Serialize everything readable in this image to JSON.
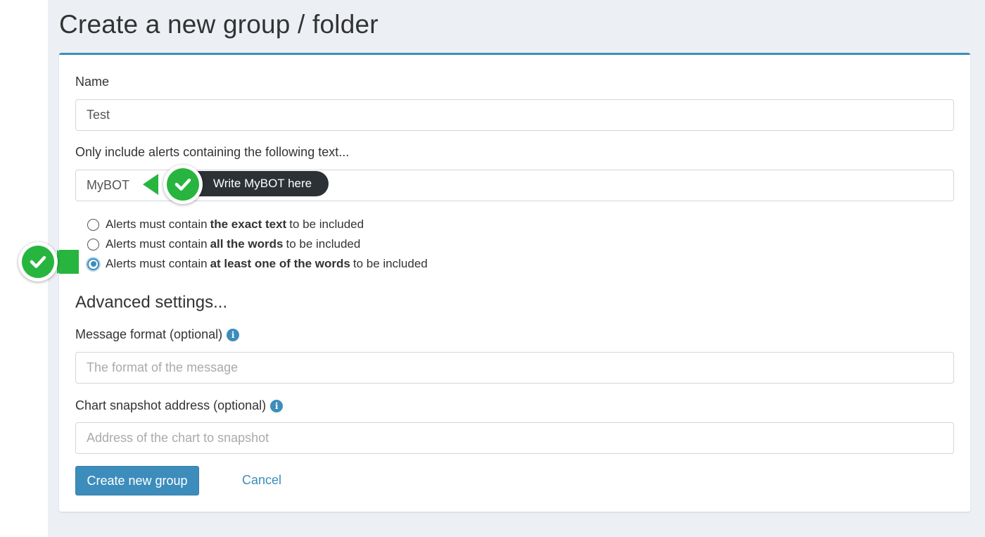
{
  "page": {
    "title": "Create a new group / folder"
  },
  "form": {
    "name_label": "Name",
    "name_value": "Test",
    "filter_label": "Only include alerts containing the following text...",
    "filter_value": "MyBOT",
    "match_options": [
      {
        "prefix": "Alerts must contain",
        "bold": "the exact text",
        "suffix": "to be included",
        "checked": false
      },
      {
        "prefix": "Alerts must contain",
        "bold": "all the words",
        "suffix": "to be included",
        "checked": false
      },
      {
        "prefix": "Alerts must contain",
        "bold": "at least one of the words",
        "suffix": "to be included",
        "checked": true
      }
    ],
    "advanced_title": "Advanced settings...",
    "message_format_label": "Message format (optional)",
    "message_format_placeholder": "The format of the message",
    "message_format_value": "",
    "snapshot_label": "Chart snapshot address (optional)",
    "snapshot_placeholder": "Address of the chart to snapshot",
    "snapshot_value": "",
    "info_icon_glyph": "i",
    "create_button_label": "Create new group",
    "cancel_label": "Cancel"
  },
  "annotations": {
    "tooltip_text": "Write MyBOT here",
    "badge_icon": "check-icon"
  },
  "colors": {
    "accent": "#3c8dbc",
    "annotation_green": "#27b53f",
    "tooltip_dark": "#2c3136",
    "background": "#ecf0f5"
  }
}
